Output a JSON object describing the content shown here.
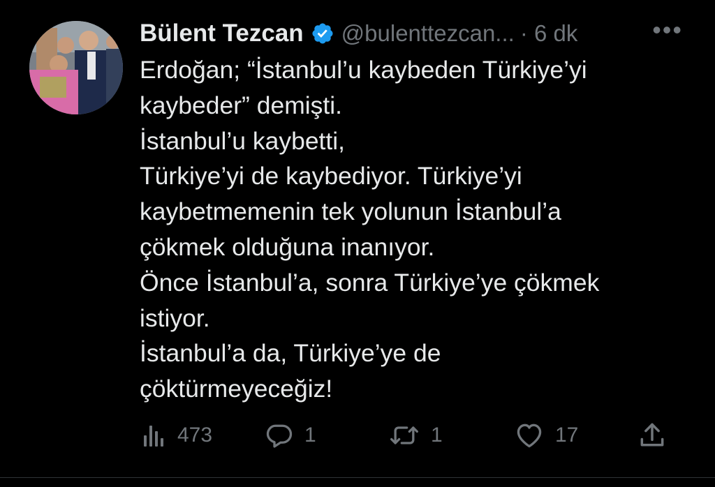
{
  "author": {
    "name": "Bülent Tezcan",
    "handle": "@bulenttezcan...",
    "time": "· 6 dk",
    "verified": true
  },
  "more_label": "•••",
  "body_lines": [
    "Erdoğan; “İstanbul’u kaybeden Türkiye’yi",
    "kaybeder” demişti.",
    "İstanbul’u kaybetti,",
    "Türkiye’yi de kaybediyor. Türkiye’yi",
    "kaybetmemenin tek yolunun İstanbul’a",
    "çökmek olduğuna inanıyor.",
    "Önce İstanbul’a, sonra Türkiye’ye çökmek",
    "istiyor.",
    "İstanbul’a da, Türkiye’ye de",
    "çöktürmeyeceğiz!"
  ],
  "actions": {
    "views": {
      "icon": "analytics-icon",
      "count": "473"
    },
    "reply": {
      "icon": "reply-icon",
      "count": "1"
    },
    "retweet": {
      "icon": "retweet-icon",
      "count": "1"
    },
    "like": {
      "icon": "heart-icon",
      "count": "17"
    },
    "share": {
      "icon": "share-icon"
    }
  },
  "colors": {
    "background": "#000000",
    "text": "#e7e9ea",
    "muted": "#71767b",
    "verified": "#1d9bf0"
  }
}
